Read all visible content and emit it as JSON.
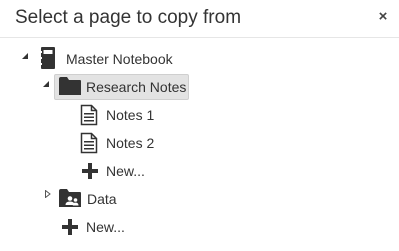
{
  "dialog": {
    "title": "Select a page to copy from",
    "close_label": "×"
  },
  "tree": {
    "notebook": {
      "label": "Master Notebook",
      "expanded": true,
      "icon": "notebook-icon"
    },
    "section_research": {
      "label": "Research Notes",
      "expanded": true,
      "selected": true,
      "icon": "folder-icon"
    },
    "page_notes1": {
      "label": "Notes 1",
      "icon": "page-icon"
    },
    "page_notes2": {
      "label": "Notes 2",
      "icon": "page-icon"
    },
    "new_page": {
      "label": "New...",
      "icon": "plus-icon"
    },
    "section_data": {
      "label": "Data",
      "expanded": false,
      "icon": "shared-folder-icon"
    },
    "new_section": {
      "label": "New...",
      "icon": "plus-icon"
    }
  },
  "colors": {
    "selection_bg": "#e3e3e3",
    "icon_dark": "#333333",
    "text": "#333333"
  }
}
